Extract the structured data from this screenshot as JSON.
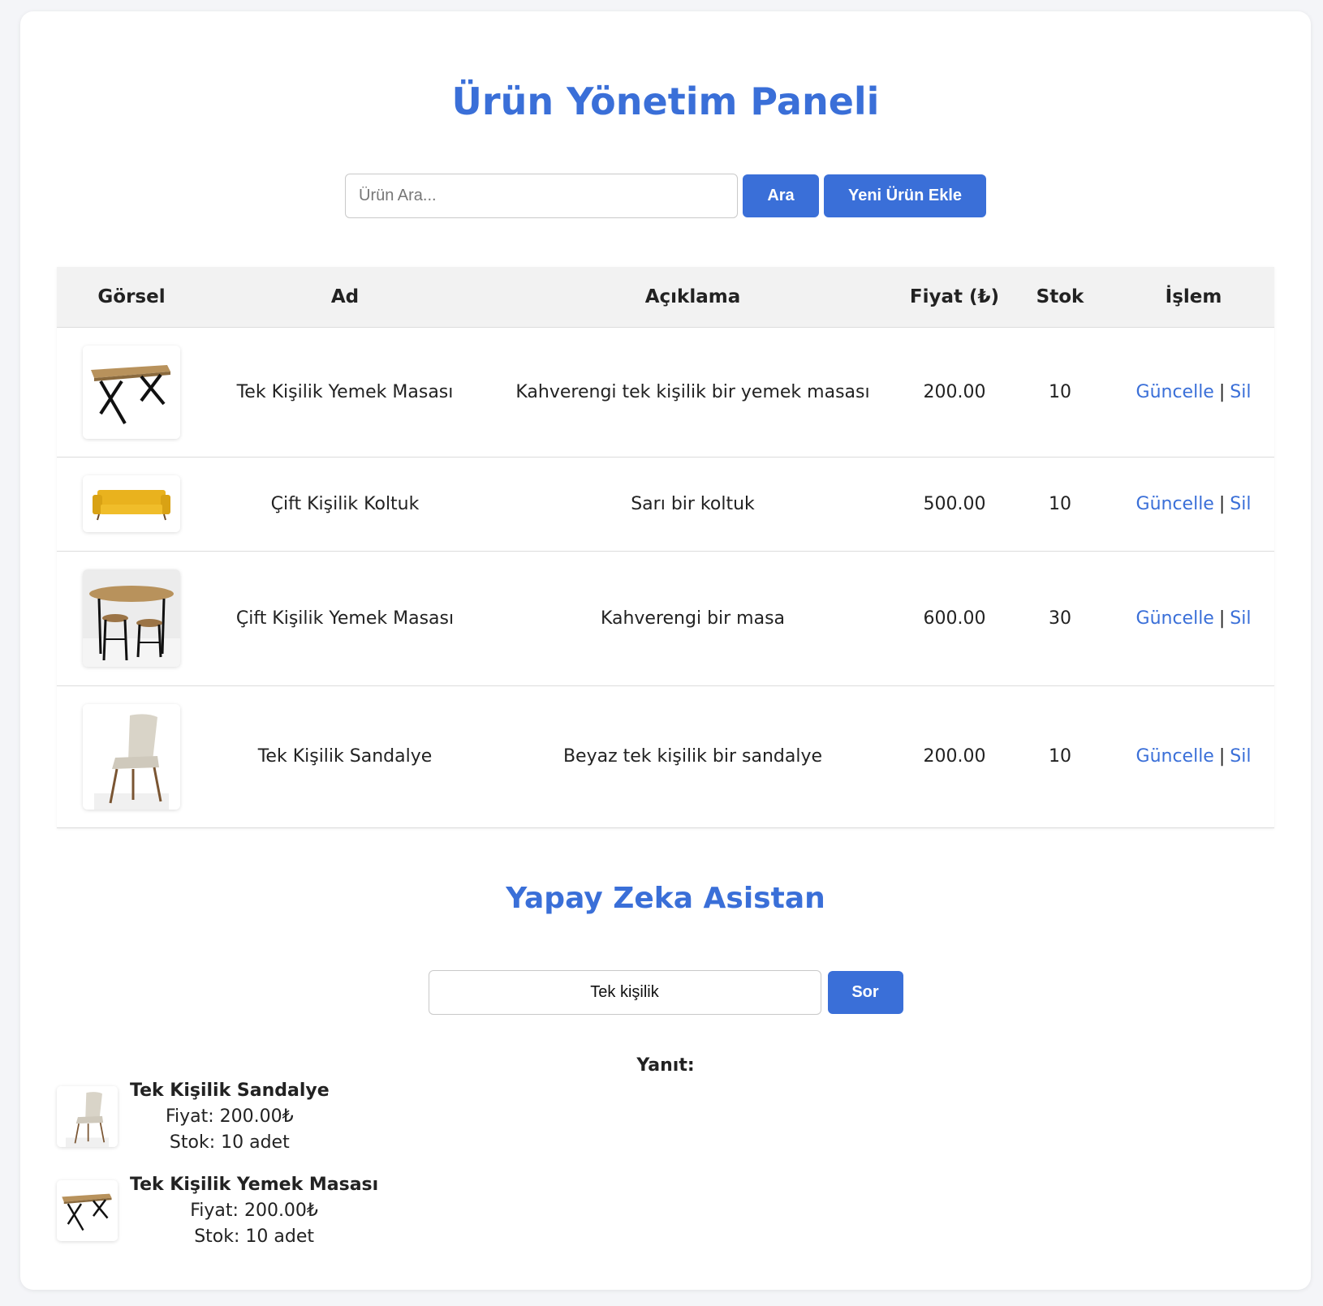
{
  "header": {
    "title": "Ürün Yönetim Paneli"
  },
  "search": {
    "placeholder": "Ürün Ara...",
    "search_button": "Ara",
    "add_button": "Yeni Ürün Ekle"
  },
  "table": {
    "columns": [
      "Görsel",
      "Ad",
      "Açıklama",
      "Fiyat (₺)",
      "Stok",
      "İşlem"
    ],
    "rows": [
      {
        "image": "table-image",
        "name": "Tek Kişilik Yemek Masası",
        "description": "Kahverengi tek kişilik bir yemek masası",
        "price": "200.00",
        "stock": "10",
        "update": "Güncelle",
        "separator": "|",
        "delete": "Sil"
      },
      {
        "image": "sofa-image",
        "name": "Çift Kişilik Koltuk",
        "description": "Sarı bir koltuk",
        "price": "500.00",
        "stock": "10",
        "update": "Güncelle",
        "separator": "|",
        "delete": "Sil"
      },
      {
        "image": "dining-set-image",
        "name": "Çift Kişilik Yemek Masası",
        "description": "Kahverengi bir masa",
        "price": "600.00",
        "stock": "30",
        "update": "Güncelle",
        "separator": "|",
        "delete": "Sil"
      },
      {
        "image": "chair-image",
        "name": "Tek Kişilik Sandalye",
        "description": "Beyaz tek kişilik bir sandalye",
        "price": "200.00",
        "stock": "10",
        "update": "Güncelle",
        "separator": "|",
        "delete": "Sil"
      }
    ]
  },
  "assistant": {
    "title": "Yapay Zeka Asistan",
    "query_value": "Tek kişilik",
    "ask_button": "Sor",
    "answer_label": "Yanıt:",
    "results": [
      {
        "image": "chair-image",
        "name": "Tek Kişilik Sandalye",
        "price_line": "Fiyat: 200.00₺",
        "stock_line": "Stok: 10 adet"
      },
      {
        "image": "table-image",
        "name": "Tek Kişilik Yemek Masası",
        "price_line": "Fiyat: 200.00₺",
        "stock_line": "Stok: 10 adet"
      }
    ]
  },
  "colors": {
    "accent": "#3a6fd8",
    "header_bg": "#f2f2f2",
    "page_bg": "#f4f5f8"
  }
}
